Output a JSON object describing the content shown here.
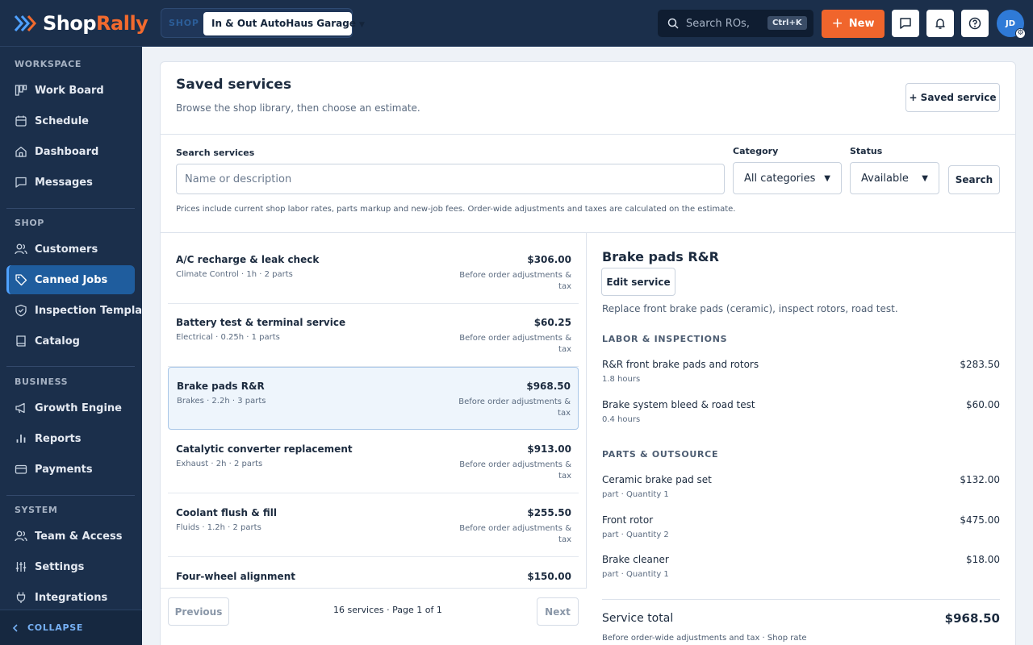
{
  "brand": {
    "name_a": "Shop",
    "name_b": "Rally"
  },
  "topbar": {
    "shop_label": "SHOP",
    "shop_name": "In & Out AutoHaus Garage",
    "search_placeholder": "Search ROs,",
    "search_shortcut": "Ctrl+K",
    "new_label": "New",
    "avatar_initials": "JD"
  },
  "sidebar": {
    "sections": [
      "WORKSPACE",
      "SHOP",
      "BUSINESS",
      "SYSTEM"
    ],
    "items": [
      {
        "label": "Work Board",
        "icon": "board-icon"
      },
      {
        "label": "Schedule",
        "icon": "calendar-icon"
      },
      {
        "label": "Dashboard",
        "icon": "home-icon"
      },
      {
        "label": "Messages",
        "icon": "message-icon"
      },
      {
        "label": "Customers",
        "icon": "users-icon"
      },
      {
        "label": "Canned Jobs",
        "icon": "tag-icon"
      },
      {
        "label": "Inspection Templates",
        "icon": "shield-icon"
      },
      {
        "label": "Catalog",
        "icon": "book-icon"
      },
      {
        "label": "Growth Engine",
        "icon": "megaphone-icon"
      },
      {
        "label": "Reports",
        "icon": "bar-chart-icon"
      },
      {
        "label": "Payments",
        "icon": "credit-card-icon"
      },
      {
        "label": "Team & Access",
        "icon": "team-icon"
      },
      {
        "label": "Settings",
        "icon": "sliders-icon"
      },
      {
        "label": "Integrations",
        "icon": "plug-icon"
      }
    ],
    "collapse_label": "COLLAPSE"
  },
  "page": {
    "title": "Saved services",
    "subtitle": "Browse the shop library, then choose an estimate.",
    "add_button": "+ Saved service"
  },
  "filters": {
    "search_label": "Search services",
    "search_placeholder": "Name or description",
    "category_label": "Category",
    "category_value": "All categories",
    "status_label": "Status",
    "status_value": "Available",
    "search_button": "Search",
    "note": "Prices include current shop labor rates, parts markup and new-job fees. Order-wide adjustments and taxes are calculated on the estimate."
  },
  "services": [
    {
      "name": "A/C recharge & leak check",
      "meta": "Climate Control · 1h · 2 parts",
      "price": "$306.00",
      "note": "Before order adjustments & tax"
    },
    {
      "name": "Battery test & terminal service",
      "meta": "Electrical · 0.25h · 1 parts",
      "price": "$60.25",
      "note": "Before order adjustments & tax"
    },
    {
      "name": "Brake pads R&R",
      "meta": "Brakes · 2.2h · 3 parts",
      "price": "$968.50",
      "note": "Before order adjustments & tax"
    },
    {
      "name": "Catalytic converter replacement",
      "meta": "Exhaust · 2h · 2 parts",
      "price": "$913.00",
      "note": "Before order adjustments & tax"
    },
    {
      "name": "Coolant flush & fill",
      "meta": "Fluids · 1.2h · 2 parts",
      "price": "$255.50",
      "note": "Before order adjustments & tax"
    },
    {
      "name": "Four-wheel alignment",
      "meta": "",
      "price": "$150.00",
      "note": ""
    }
  ],
  "pager": {
    "prev": "Previous",
    "next": "Next",
    "summary": "16 services · Page 1 of 1"
  },
  "detail": {
    "title": "Brake pads R&R",
    "edit_button": "Edit service",
    "description": "Replace front brake pads (ceramic), inspect rotors, road test.",
    "labor_heading": "LABOR & INSPECTIONS",
    "labor": [
      {
        "name": "R&R front brake pads and rotors",
        "sub": "1.8 hours",
        "price": "$283.50"
      },
      {
        "name": "Brake system bleed & road test",
        "sub": "0.4 hours",
        "price": "$60.00"
      }
    ],
    "parts_heading": "PARTS & OUTSOURCE",
    "parts": [
      {
        "name": "Ceramic brake pad set",
        "sub": "part · Quantity 1",
        "price": "$132.00"
      },
      {
        "name": "Front rotor",
        "sub": "part · Quantity 2",
        "price": "$475.00"
      },
      {
        "name": "Brake cleaner",
        "sub": "part · Quantity 1",
        "price": "$18.00"
      }
    ],
    "total_label": "Service total",
    "total_value": "$968.50",
    "total_note": "Before order-wide adjustments and tax · Shop rate"
  },
  "colors": {
    "navy": "#1b2f4b",
    "accent": "#f0652c",
    "active": "#1f5d9e",
    "link": "#77b1f5"
  }
}
